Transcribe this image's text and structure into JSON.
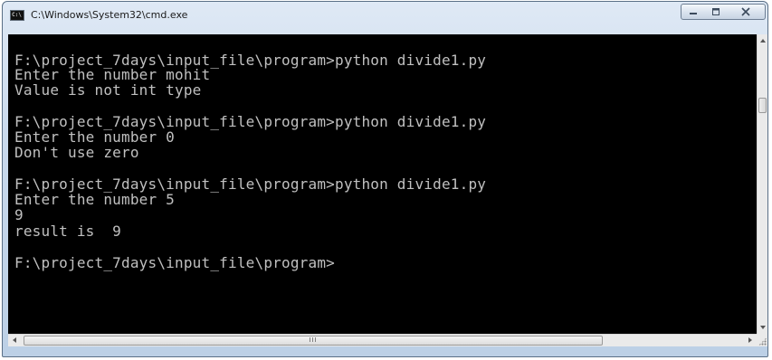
{
  "window": {
    "title": "C:\\Windows\\System32\\cmd.exe",
    "icon": "cmd-app-icon",
    "icon_text": "C:\\"
  },
  "controls": {
    "minimize_icon": "minimize-icon",
    "maximize_icon": "maximize-icon",
    "close_icon": "close-icon"
  },
  "console": {
    "lines": [
      "F:\\project_7days\\input_file\\program>python divide1.py",
      "Enter the number mohit",
      "Value is not int type",
      "",
      "F:\\project_7days\\input_file\\program>python divide1.py",
      "Enter the number 0",
      "Don't use zero",
      "",
      "F:\\project_7days\\input_file\\program>python divide1.py",
      "Enter the number 5",
      "9",
      "result is  9",
      "",
      "F:\\project_7days\\input_file\\program>"
    ]
  },
  "scrollbars": {
    "horizontal_grip": "III"
  }
}
